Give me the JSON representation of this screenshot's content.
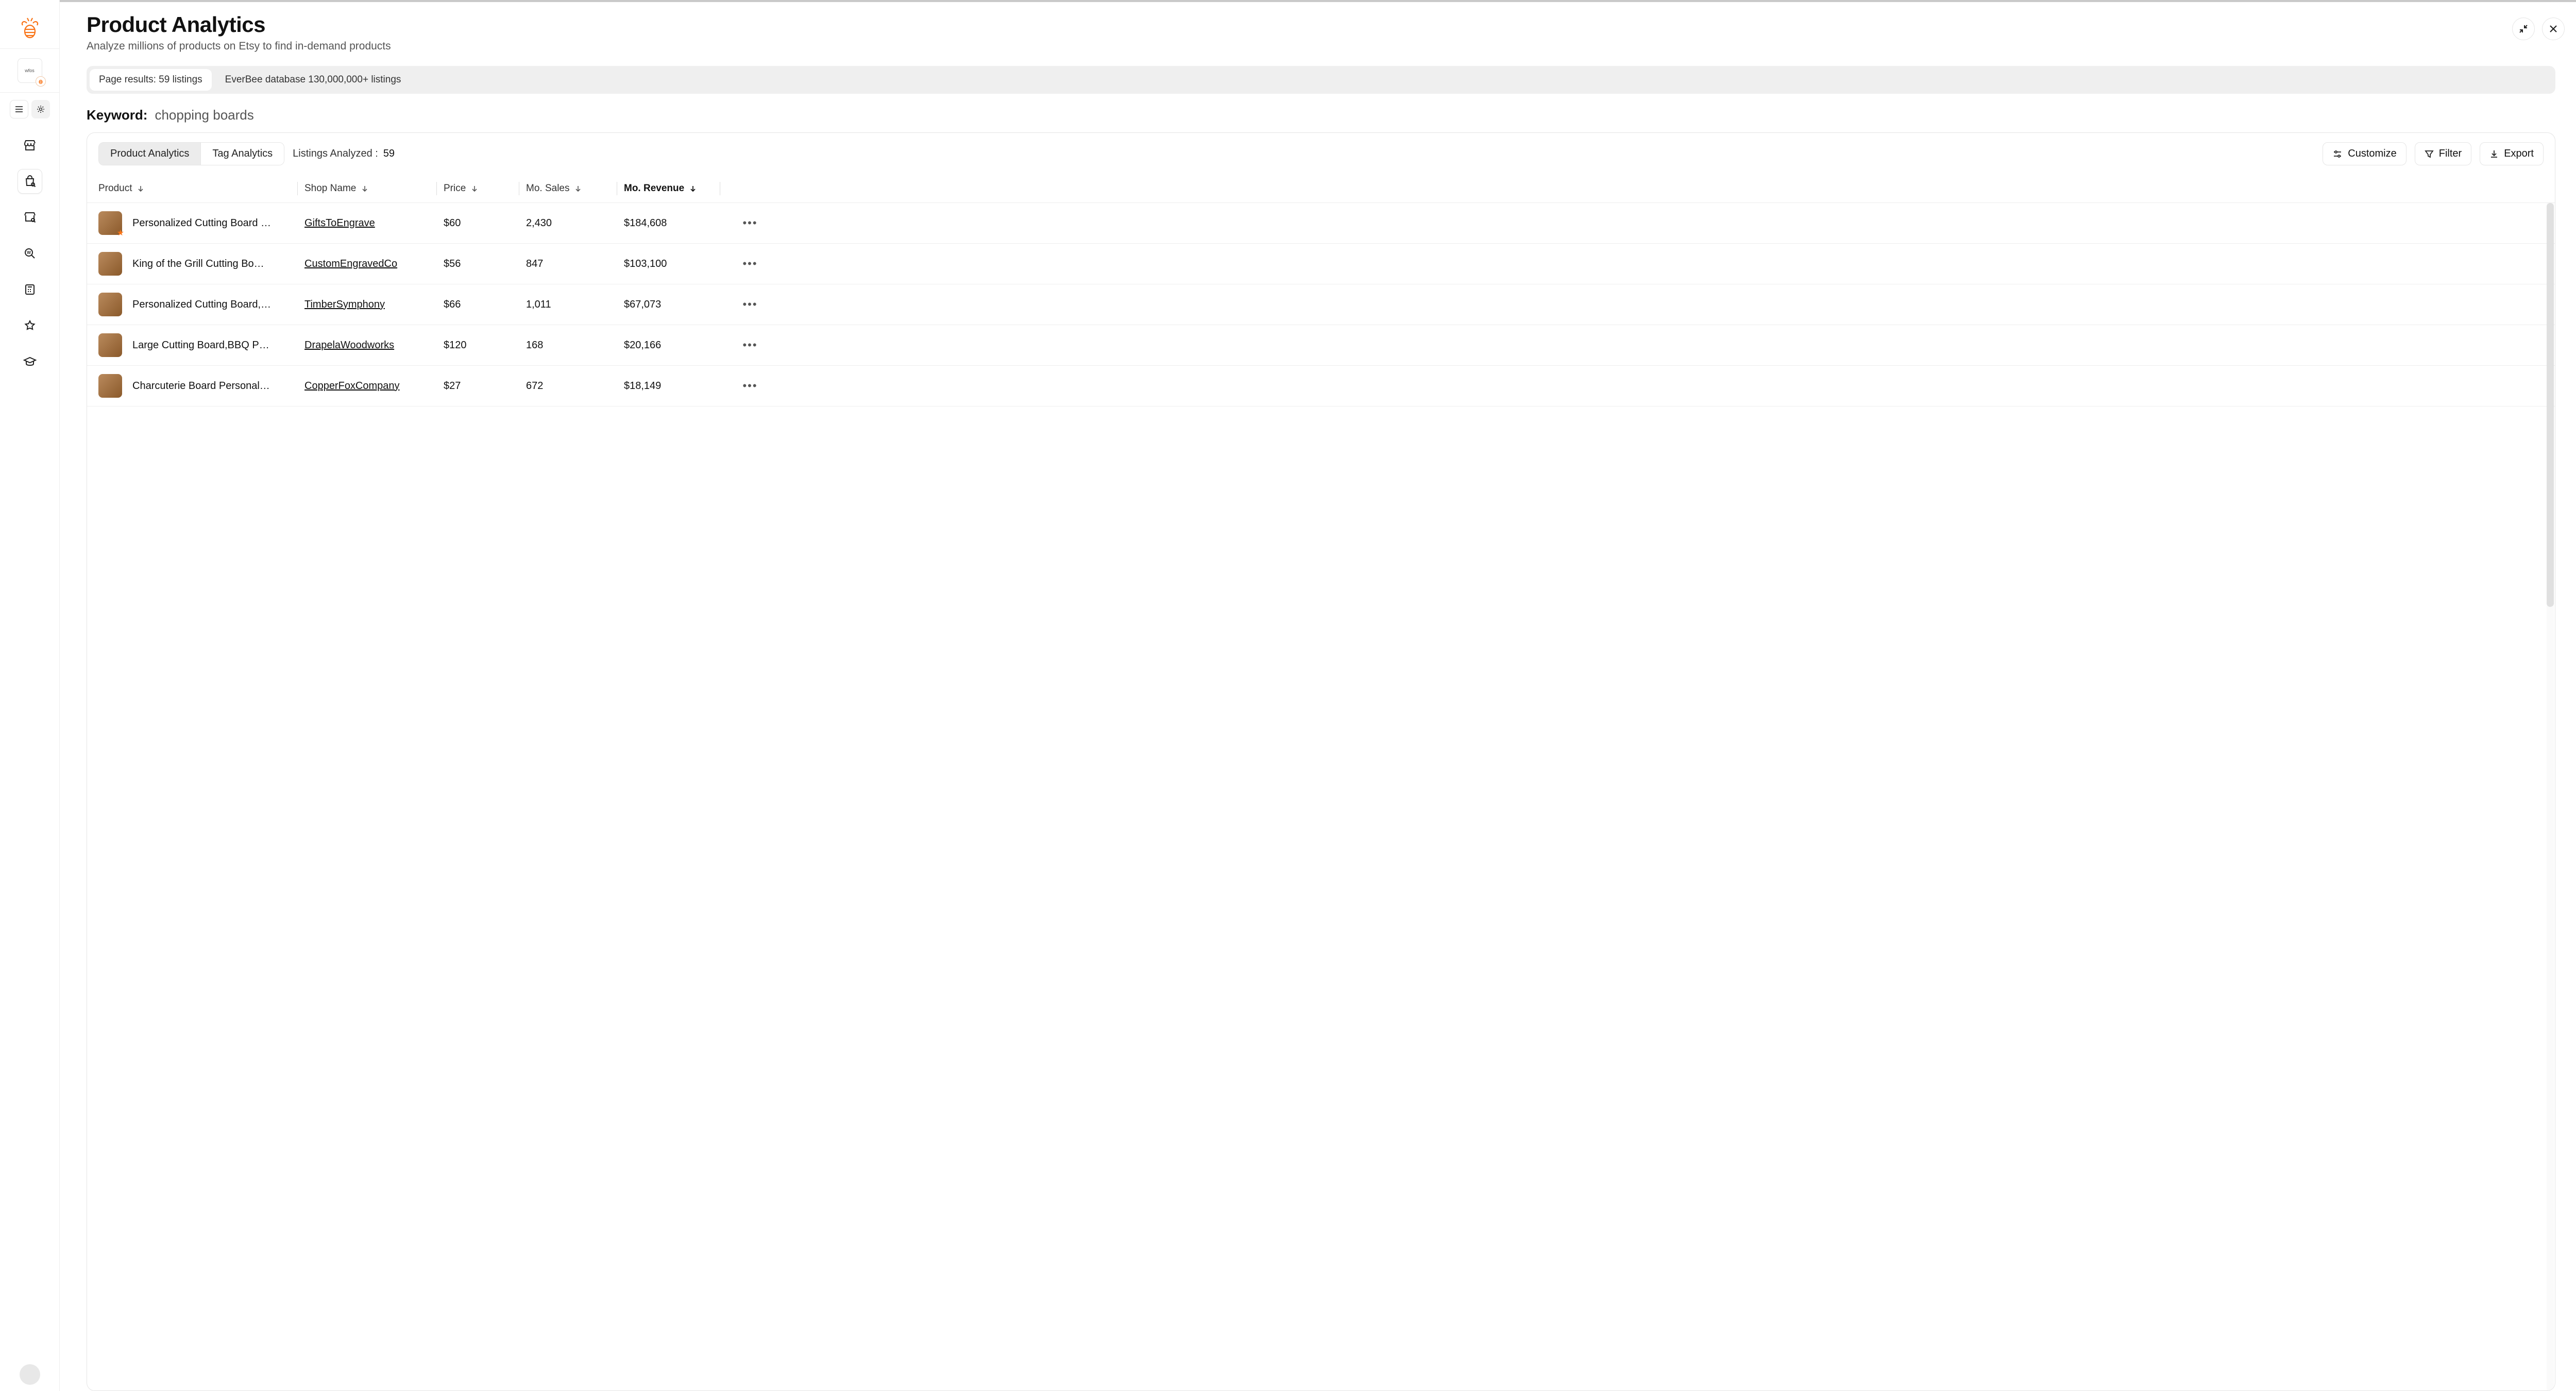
{
  "page": {
    "title": "Product Analytics",
    "subtitle": "Analyze millions of products on Etsy to find in-demand products"
  },
  "pills": {
    "page_results": "Page results: 59 listings",
    "database": "EverBee database 130,000,000+ listings"
  },
  "keyword": {
    "label": "Keyword:",
    "value": "chopping boards"
  },
  "tabs": {
    "product": "Product Analytics",
    "tag": "Tag Analytics"
  },
  "analyzed": {
    "label": "Listings Analyzed :",
    "value": "59"
  },
  "toolbar": {
    "customize": "Customize",
    "filter": "Filter",
    "export": "Export"
  },
  "columns": {
    "product": "Product",
    "shop": "Shop Name",
    "price": "Price",
    "sales": "Mo. Sales",
    "revenue": "Mo. Revenue"
  },
  "rows": [
    {
      "product": "Personalized Cutting Board …",
      "shop": "GiftsToEngrave",
      "price": "$60",
      "sales": "2,430",
      "revenue": "$184,608",
      "star": true
    },
    {
      "product": "King of the Grill Cutting Bo…",
      "shop": "CustomEngravedCo",
      "price": "$56",
      "sales": "847",
      "revenue": "$103,100",
      "star": false
    },
    {
      "product": "Personalized Cutting Board,…",
      "shop": "TimberSymphony",
      "price": "$66",
      "sales": "1,011",
      "revenue": "$67,073",
      "star": false
    },
    {
      "product": "Large Cutting Board,BBQ P…",
      "shop": "DrapelaWoodworks",
      "price": "$120",
      "sales": "168",
      "revenue": "$20,166",
      "star": false
    },
    {
      "product": "Charcuterie Board Personal…",
      "shop": "CopperFoxCompany",
      "price": "$27",
      "sales": "672",
      "revenue": "$18,149",
      "star": false
    }
  ],
  "store_badge": "wfos"
}
